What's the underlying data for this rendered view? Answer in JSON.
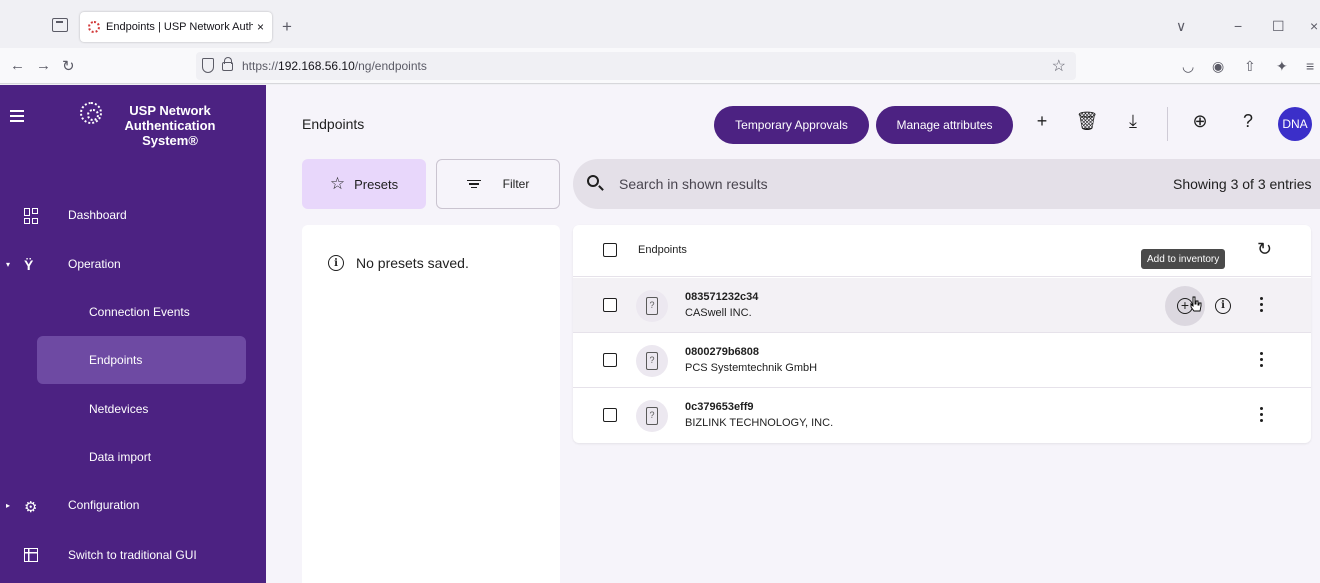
{
  "browser": {
    "tab_title": "Endpoints | USP Network Authe",
    "tab_close": "×",
    "new_tab": "+",
    "url_host": "192.168.56.10",
    "url_prefix": "https://",
    "url_path": "/ng/endpoints",
    "window_controls": [
      "∨",
      "−",
      "☐",
      "×"
    ]
  },
  "sidebar": {
    "brand": [
      "USP Network",
      "Authentication",
      "System®"
    ],
    "items": [
      {
        "label": "Dashboard"
      },
      {
        "label": "Operation"
      },
      {
        "label": "Connection Events"
      },
      {
        "label": "Endpoints"
      },
      {
        "label": "Netdevices"
      },
      {
        "label": "Data import"
      },
      {
        "label": "Configuration"
      },
      {
        "label": "Switch to traditional GUI"
      }
    ]
  },
  "header": {
    "title": "Endpoints",
    "temp_approvals": "Temporary Approvals",
    "manage_attributes": "Manage attributes",
    "avatar": "DNA"
  },
  "toolbar": {
    "presets_label": "Presets",
    "filter_label": "Filter",
    "search_placeholder": "Search in shown results",
    "showing": "Showing 3 of 3 entries"
  },
  "presets_panel": {
    "empty": "No presets saved."
  },
  "table": {
    "header": "Endpoints",
    "rows": [
      {
        "mac": "083571232c34",
        "vendor": "CASwell INC."
      },
      {
        "mac": "0800279b6808",
        "vendor": "PCS Systemtechnik GmbH"
      },
      {
        "mac": "0c379653eff9",
        "vendor": "BIZLINK TECHNOLOGY, INC."
      }
    ]
  },
  "tooltip": "Add to inventory",
  "colors": {
    "sidebar": "#4c2282",
    "accent_pill": "#4c2282",
    "presets_bg": "#e8d7fb",
    "avatar": "#3b2fc9"
  }
}
